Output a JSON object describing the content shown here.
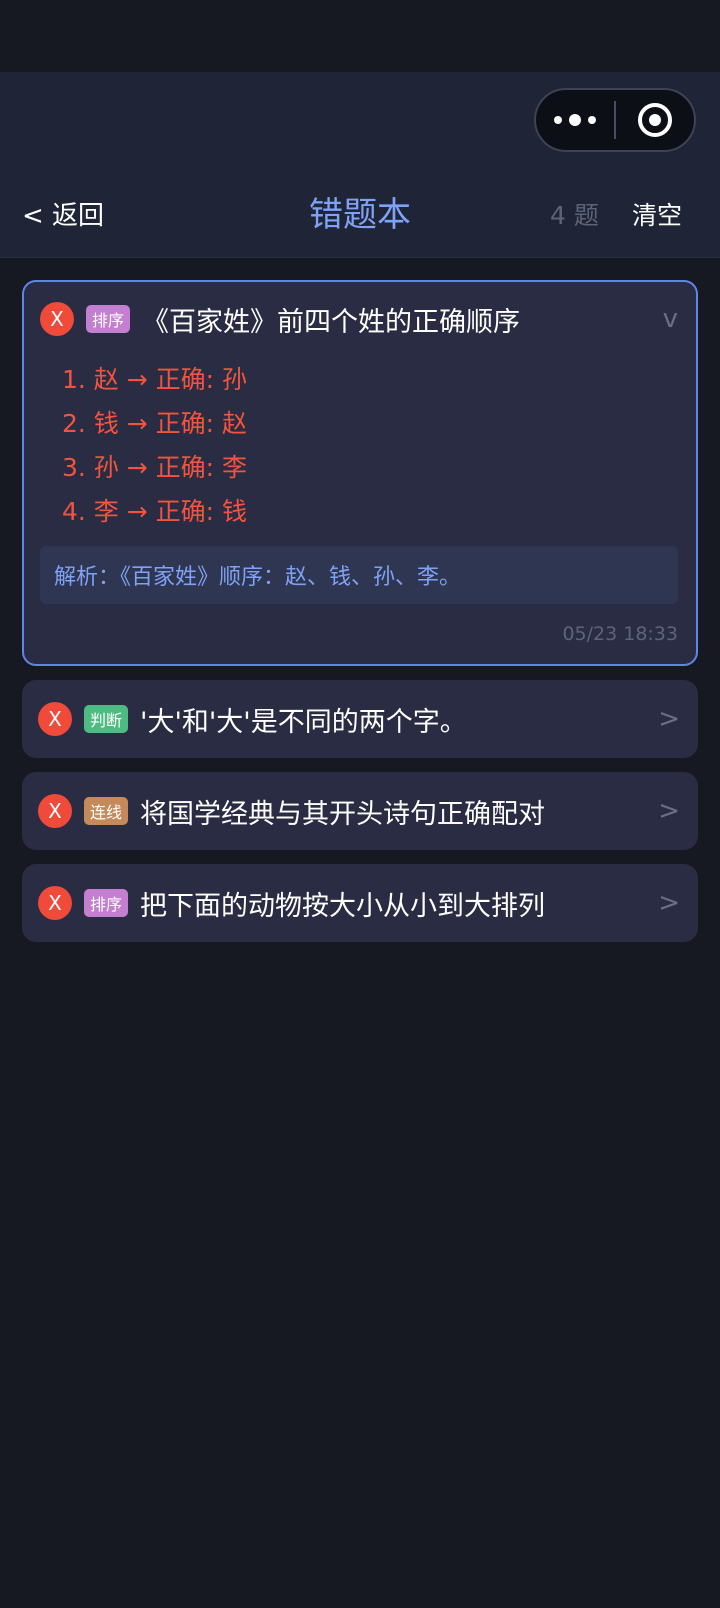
{
  "nav": {
    "back_label": "< 返回",
    "title": "错题本",
    "count_label": "4 题",
    "clear_label": "清空"
  },
  "questions": [
    {
      "wrong_mark": "X",
      "type": "排序",
      "type_color": "#c47fd1",
      "text": "《百家姓》前四个姓的正确顺序",
      "chevron": "v",
      "answers": [
        "1. 赵 → 正确: 孙",
        "2. 钱 → 正确: 赵",
        "3. 孙 → 正确: 李",
        "4. 李 → 正确: 钱"
      ],
      "analysis": "解析：《百家姓》顺序：赵、钱、孙、李。",
      "time": "05/23 18:33"
    },
    {
      "wrong_mark": "X",
      "type": "判断",
      "type_color": "#4dbb82",
      "text": "'大'和'大'是不同的两个字。",
      "chevron": ">"
    },
    {
      "wrong_mark": "X",
      "type": "连线",
      "type_color": "#c48a5a",
      "text": "将国学经典与其开头诗句正确配对",
      "chevron": ">"
    },
    {
      "wrong_mark": "X",
      "type": "排序",
      "type_color": "#c47fd1",
      "text": "把下面的动物按大小从小到大排列",
      "chevron": ">"
    }
  ],
  "colors": {
    "accent": "#7fa2f5",
    "wrong": "#f04a3a",
    "background": "#161822",
    "card": "#292c42"
  },
  "icons": {
    "capsule_more": "more-dots-icon",
    "capsule_close": "target-icon"
  }
}
